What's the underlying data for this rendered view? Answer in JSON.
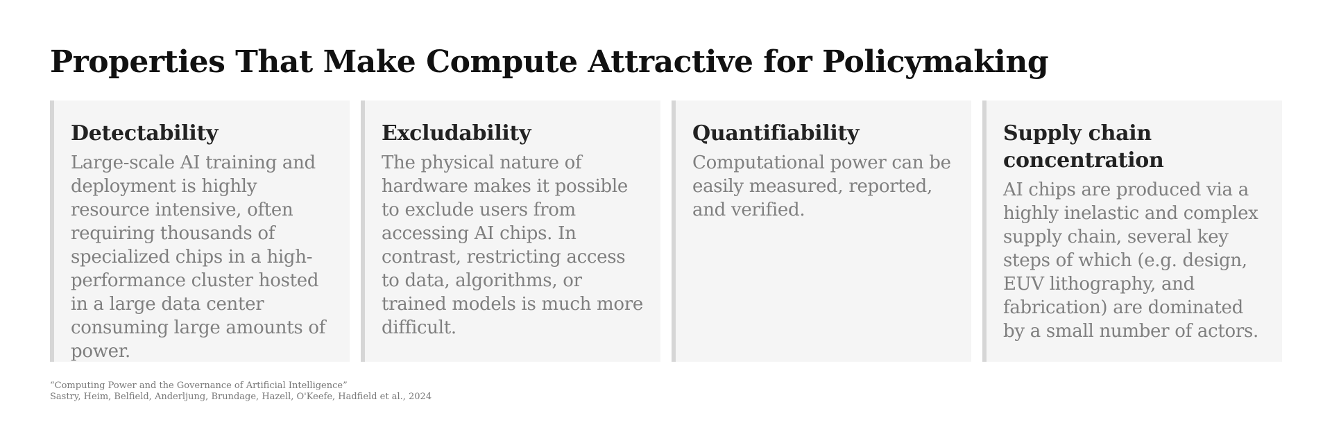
{
  "title": "Properties That Make Compute Attractive for Policymaking",
  "cards": [
    {
      "heading": "Detectability",
      "body": "Large-scale AI training and deployment is highly resource intensive, often requiring thousands of specialized chips in a high-performance cluster hosted in a large data center consuming large amounts of power."
    },
    {
      "heading": "Excludability",
      "body": "The physical nature of hardware makes it possible to exclude users from accessing AI chips. In contrast, restricting access to data, algorithms, or trained models is much more difficult."
    },
    {
      "heading": "Quantifiability",
      "body": "Computational power can be easily measured, reported, and verified."
    },
    {
      "heading": "Supply chain concentration",
      "body": "AI chips are produced via a highly inelastic and complex supply chain, several key steps of which (e.g. design, EUV lithography, and fabrication) are dominated by a small number of actors."
    }
  ],
  "citation": {
    "work": "“Computing Power and the Governance of Artificial Intelligence”",
    "authors": "Sastry, Heim, Belfield, Anderljung, Brundage, Hazell, O'Keefe, Hadfield et al., 2024"
  },
  "colors": {
    "card_background": "#f5f5f5",
    "card_accent_border": "#d6d6d6",
    "heading_text": "#222222",
    "body_text": "#7f7f7f"
  }
}
